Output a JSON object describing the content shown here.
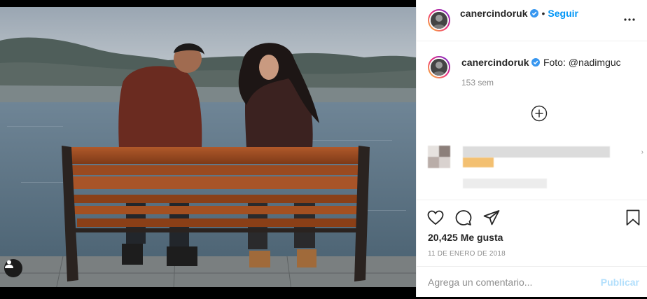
{
  "post": {
    "username": "canercindoruk",
    "follow_label": "Seguir",
    "separator": "•",
    "caption": "Foto: @nadimguc",
    "time_ago": "153 sem",
    "likes": "20,425 Me gusta",
    "date": "11 DE ENERO DE 2018"
  },
  "comment_box": {
    "placeholder": "Agrega un comentario...",
    "publish_label": "Publicar"
  },
  "icons": {
    "verified": "verified-badge-icon",
    "more": "more-options-icon",
    "load_more": "plus-circle-icon",
    "like": "heart-icon",
    "comment": "comment-icon",
    "share": "paper-plane-icon",
    "save": "bookmark-icon",
    "tag": "user-tag-icon"
  },
  "colors": {
    "accent": "#0095f6",
    "publish_disabled": "#b2dffc",
    "muted": "#8e8e8e"
  }
}
